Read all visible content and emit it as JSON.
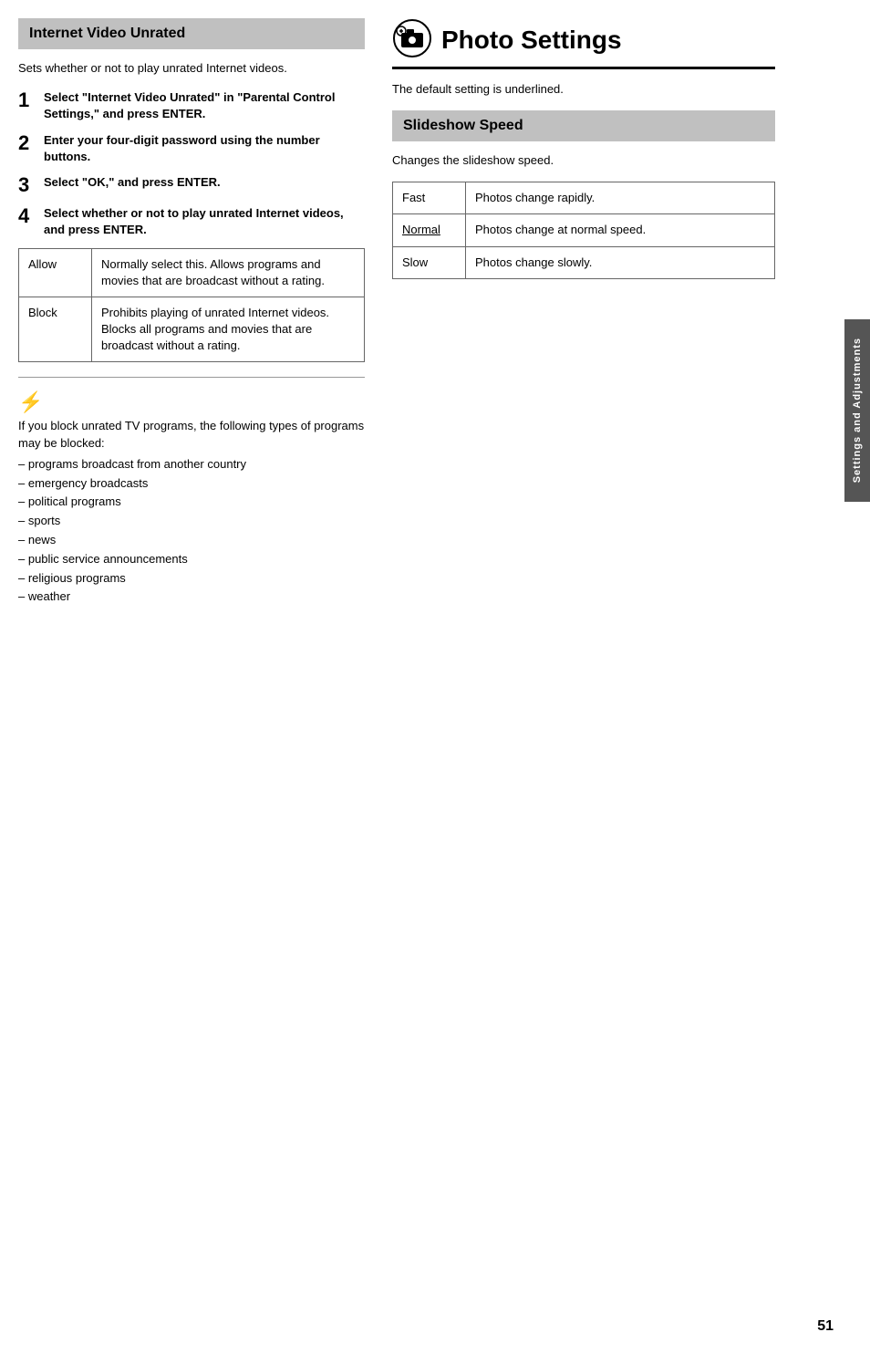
{
  "left": {
    "section_title": "Internet Video Unrated",
    "intro": "Sets whether or not to play unrated Internet videos.",
    "steps": [
      {
        "number": "1",
        "text": "Select \"Internet Video Unrated\" in \"Parental Control Settings,\" and press ENTER."
      },
      {
        "number": "2",
        "text": "Enter your four-digit password using the number buttons."
      },
      {
        "number": "3",
        "text": "Select \"OK,\" and press ENTER."
      },
      {
        "number": "4",
        "text": "Select whether or not to play unrated Internet videos, and press ENTER."
      }
    ],
    "options_table": [
      {
        "option": "Allow",
        "description": "Normally select this. Allows programs and movies that are broadcast without a rating."
      },
      {
        "option": "Block",
        "description": "Prohibits playing of unrated Internet videos. Blocks all programs and movies that are broadcast without a rating."
      }
    ],
    "note_icon": "⚡",
    "note_intro": "If you block unrated TV programs, the following types of programs may be blocked:",
    "note_list": [
      "– programs broadcast from another country",
      "– emergency broadcasts",
      "– political programs",
      "– sports",
      "– news",
      "– public service announcements",
      "– religious programs",
      "– weather"
    ]
  },
  "right": {
    "section_title": "Photo Settings",
    "default_note": "The default setting is underlined.",
    "slideshow": {
      "title": "Slideshow Speed",
      "intro": "Changes the slideshow speed.",
      "options": [
        {
          "option": "Fast",
          "description": "Photos change rapidly."
        },
        {
          "option": "Normal",
          "description": "Photos change at normal speed.",
          "underline": true
        },
        {
          "option": "Slow",
          "description": "Photos change slowly."
        }
      ]
    }
  },
  "sidebar_label": "Settings and Adjustments",
  "page_number": "51"
}
